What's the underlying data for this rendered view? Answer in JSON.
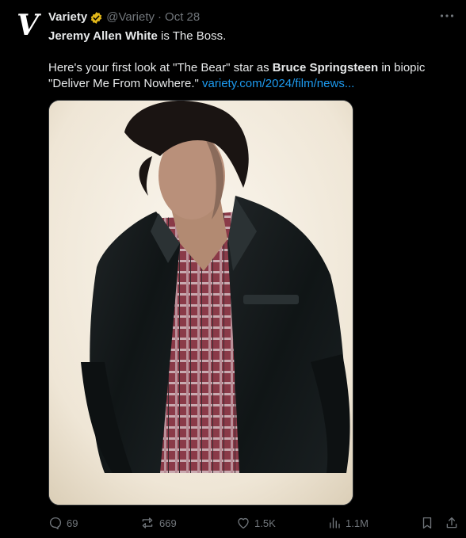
{
  "author": {
    "name": "Variety",
    "handle": "@Variety",
    "separator": "·",
    "time": "Oct 28",
    "avatar_letter": "V"
  },
  "tweet": {
    "line1_bold": "Jeremy Allen White",
    "line1_rest": " is The Boss.",
    "line2_a": "Here's your first look at \"The Bear\" star as ",
    "line2_bold": "Bruce Springsteen",
    "line2_b": " in biopic \"Deliver Me From Nowhere.\" ",
    "link": "variety.com/2024/film/news..."
  },
  "actions": {
    "replies": "69",
    "reposts": "669",
    "likes": "1.5K",
    "views": "1.1M"
  },
  "icons": {
    "verified": "verified-gold-badge-icon",
    "more": "more-dots-icon",
    "reply": "reply-icon",
    "repost": "repost-icon",
    "like": "heart-icon",
    "views": "views-chart-icon",
    "bookmark": "bookmark-icon",
    "share": "share-icon"
  },
  "colors": {
    "background": "#000000",
    "text": "#e7e9ea",
    "secondary": "#71767b",
    "link": "#1d9bf0",
    "verified": "#e2b719"
  }
}
